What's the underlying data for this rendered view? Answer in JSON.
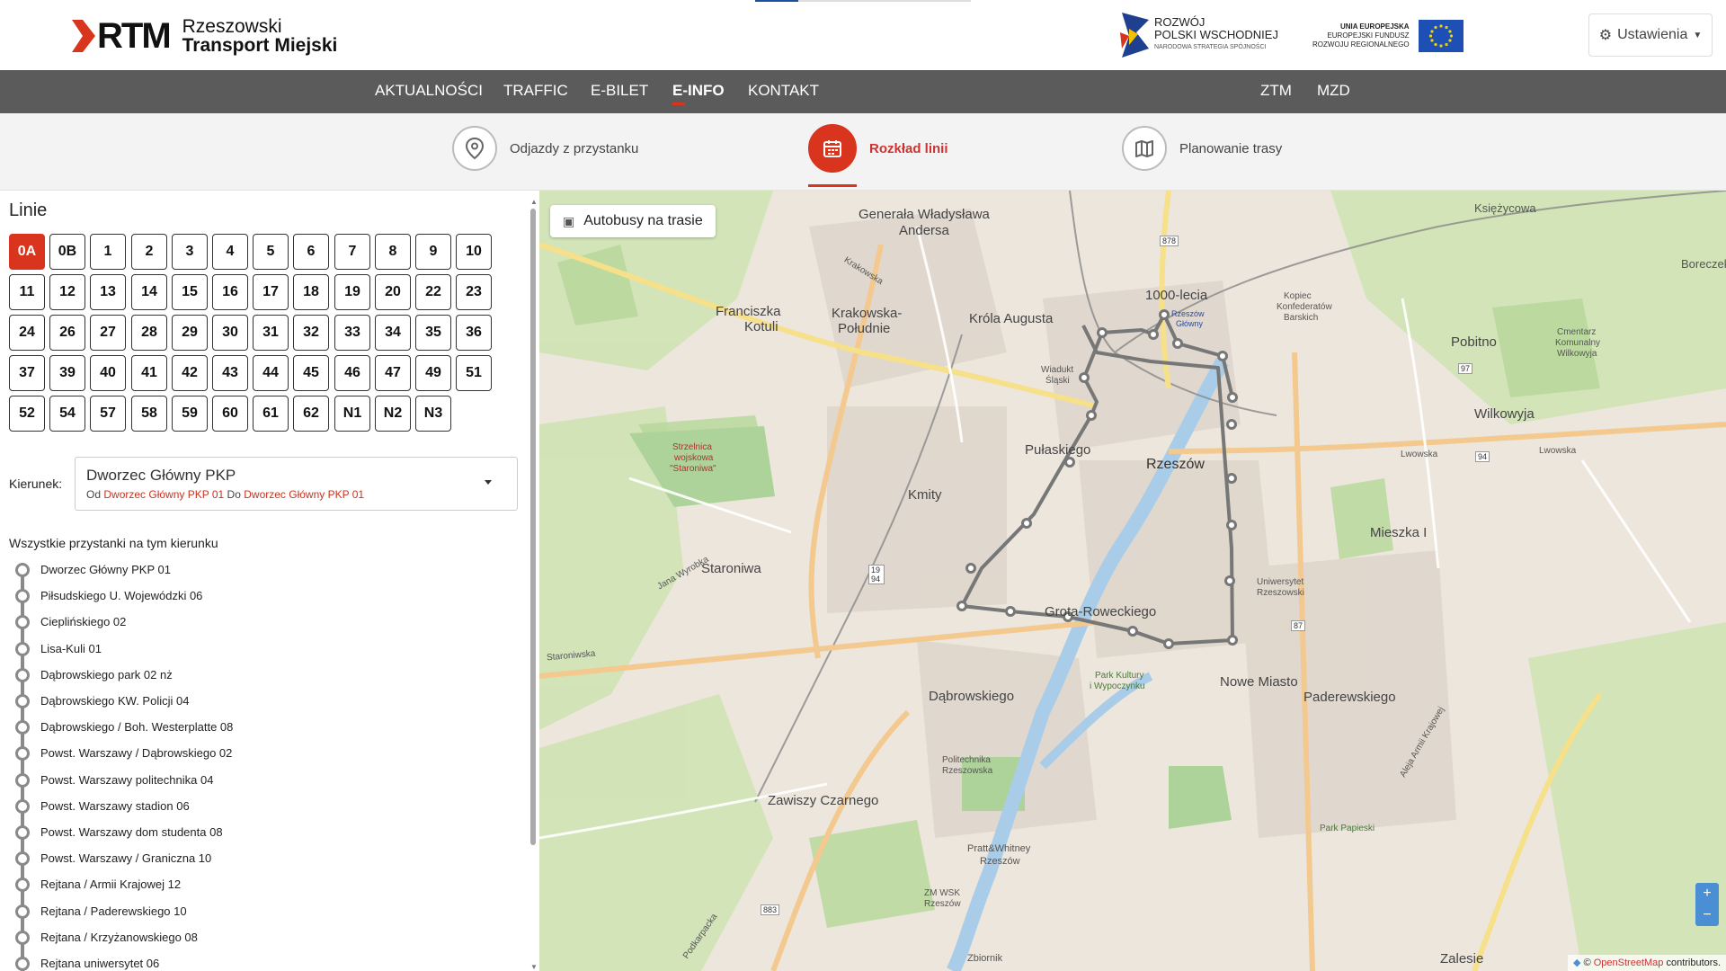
{
  "header": {
    "logo_mark": "RTM",
    "logo_line1": "Rzeszowski",
    "logo_line2": "Transport Miejski",
    "partner1_line1": "ROZWÓJ",
    "partner1_line2": "POLSKI WSCHODNIEJ",
    "partner1_line3": "NARODOWA STRATEGIA SPÓJNOŚCI",
    "partner2_line1": "UNIA EUROPEJSKA",
    "partner2_line2": "EUROPEJSKI FUNDUSZ",
    "partner2_line3": "ROZWOJU REGIONALNEGO",
    "settings_label": "Ustawienia"
  },
  "nav": {
    "items": [
      "AKTUALNOŚCI",
      "TRAFFIC",
      "E-BILET",
      "E-INFO",
      "KONTAKT"
    ],
    "right_items": [
      "ZTM",
      "MZD"
    ],
    "active": "E-INFO"
  },
  "modes": {
    "departures": "Odjazdy z przystanku",
    "schedule": "Rozkład linii",
    "planner": "Planowanie trasy",
    "active": "Rozkład linii"
  },
  "panel": {
    "title": "Linie",
    "lines": [
      "0A",
      "0B",
      "1",
      "2",
      "3",
      "4",
      "5",
      "6",
      "7",
      "8",
      "9",
      "10",
      "11",
      "12",
      "13",
      "14",
      "15",
      "16",
      "17",
      "18",
      "19",
      "20",
      "22",
      "23",
      "24",
      "26",
      "27",
      "28",
      "29",
      "30",
      "31",
      "32",
      "33",
      "34",
      "35",
      "36",
      "37",
      "39",
      "40",
      "41",
      "42",
      "43",
      "44",
      "45",
      "46",
      "47",
      "49",
      "51",
      "52",
      "54",
      "57",
      "58",
      "59",
      "60",
      "61",
      "62",
      "N1",
      "N2",
      "N3"
    ],
    "active_line": "0A",
    "direction_label": "Kierunek:",
    "direction_value": "Dworzec Główny PKP",
    "direction_from_label": "Od",
    "direction_from": "Dworzec Główny PKP 01",
    "direction_to_label": "Do",
    "direction_to": "Dworzec Główny PKP 01",
    "stops_title": "Wszystkie przystanki na tym kierunku",
    "stops": [
      "Dworzec Główny PKP 01",
      "Piłsudskiego U. Wojewódzki 06",
      "Cieplińskiego 02",
      "Lisa-Kuli 01",
      "Dąbrowskiego park 02 nż",
      "Dąbrowskiego KW. Policji 04",
      "Dąbrowskiego / Boh. Westerplatte 08",
      "Powst. Warszawy / Dąbrowskiego 02",
      "Powst. Warszawy politechnika 04",
      "Powst. Warszawy stadion 06",
      "Powst. Warszawy dom studenta 08",
      "Powst. Warszawy / Graniczna 10",
      "Rejtana / Armii Krajowej 12",
      "Rejtana / Paderewskiego 10",
      "Rejtana / Krzyżanowskiego 08",
      "Rejtana uniwersytet 06"
    ]
  },
  "map": {
    "bus_chip": "Autobusy na trasie",
    "zoom_in": "+",
    "zoom_out": "−",
    "attribution_prefix": "©",
    "attribution_link": "OpenStreetMap",
    "attribution_suffix": "contributors.",
    "labels": {
      "generala": "Generała Władysława",
      "anders": "Andersa",
      "rzeszow": "Rzeszów",
      "krakowska_poludnie": "Krakowska-Południe",
      "krakowska_1": "Krakowska-",
      "krakowska_2": "Południe",
      "krola": "Króla Augusta",
      "franciszka": "Franciszka",
      "kotuli": "Kotuli",
      "tysiaclecia": "1000-lecia",
      "pulaskiego": "Pułaskiego",
      "kmity": "Kmity",
      "staroniwa": "Staroniwa",
      "grota": "Grota-Roweckiego",
      "dabrowskiego": "Dąbrowskiego",
      "nowe_miasto": "Nowe Miasto",
      "paderewskiego": "Paderewskiego",
      "mieszka": "Mieszka I",
      "pobitno": "Pobitno",
      "wilkowyja": "Wilkowyja",
      "zawiszy": "Zawiszy Czarnego",
      "zalesie": "Zalesie",
      "ksiezycowa": "Księżycowa",
      "boreczek": "Boreczek",
      "strzelnica_1": "Strzelnica",
      "strzelnica_2": "wojskowa",
      "strzelnica_3": "\"Staroniwa\"",
      "cmentarz_1": "Cmentarz",
      "cmentarz_2": "Komunalny",
      "cmentarz_3": "Wilkowyja",
      "park_kultury_1": "Park Kultury",
      "park_kultury_2": "i Wypoczynku",
      "politechnika_1": "Politechnika",
      "politechnika_2": "Rzeszowska",
      "pratt_1": "Pratt&Whitney",
      "pratt_2": "Rzeszów",
      "uniwersytet_1": "Uniwersytet",
      "uniwersytet_2": "Rzeszowski",
      "park_papieski": "Park Papieski",
      "wiadukt_1": "Wiadukt",
      "wiadukt_2": "Śląski",
      "kopiec_1": "Kopiec",
      "kopiec_2": "Konfederatów",
      "kopiec_3": "Barskich",
      "zm_wsk_1": "ZM WSK",
      "zm_wsk_2": "Rzeszów",
      "lwowska": "Lwowska",
      "krakowska": "Krakowska",
      "podkarpacka": "Podkarpacka",
      "aleja_armii": "Aleja Armii Krajowej",
      "staroniwska": "Staroniwska",
      "jana_wyrobka": "Jana Wyrobka",
      "dworzec_1": "Rzeszów",
      "dworzec_2": "Główny",
      "zbiornik": "Zbiornik"
    },
    "road_numbers": [
      "878",
      "97",
      "94",
      "19 94",
      "87",
      "883"
    ]
  }
}
